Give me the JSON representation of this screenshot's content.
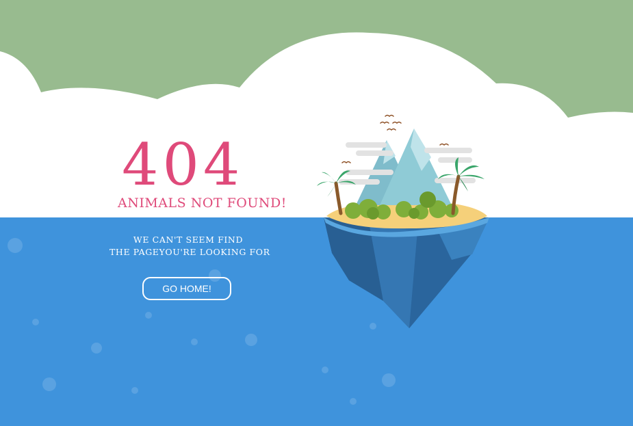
{
  "error": {
    "code": "404",
    "headline": "ANIMALS NOT FOUND!",
    "message_line1": "WE CAN'T SEEM FIND",
    "message_line2": "THE PAGEYOU'RE LOOKING FOR"
  },
  "actions": {
    "go_home_label": "GO HOME!"
  },
  "colors": {
    "sky": "#98bb8f",
    "cloud": "#ffffff",
    "sea": "#3f93dc",
    "accent_text": "#df4a7a",
    "iceberg": "#2f6fa8",
    "sand": "#f5d07a",
    "mountain": "#8fcbd6",
    "palm": "#3aa56a"
  },
  "icons": [
    "island-illustration",
    "bird-icon",
    "palm-tree-icon",
    "bubble-icon"
  ]
}
